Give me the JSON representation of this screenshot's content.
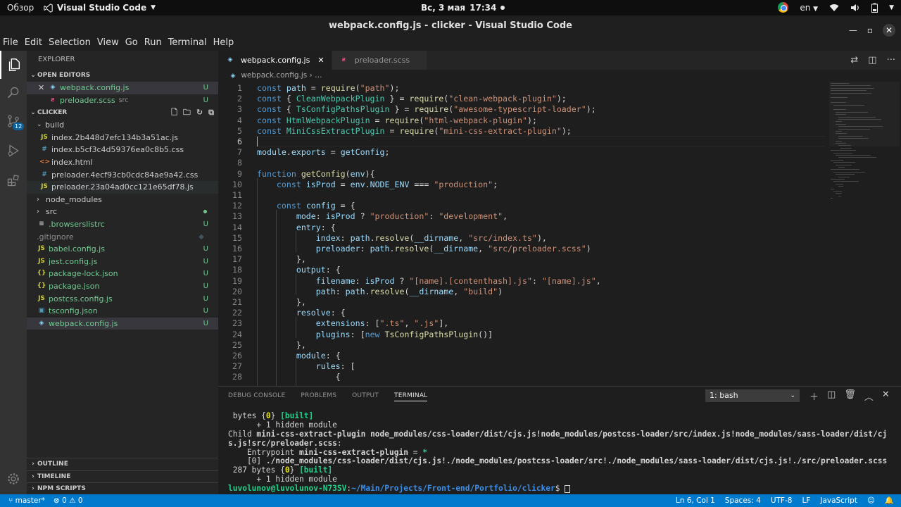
{
  "gnome": {
    "activities": "Обзор",
    "app_name": "Visual Studio Code",
    "date": "Вс, 3 мая",
    "time": "17:34",
    "language": "en"
  },
  "window": {
    "title": "webpack.config.js - clicker - Visual Studio Code"
  },
  "menu": [
    "File",
    "Edit",
    "Selection",
    "View",
    "Go",
    "Run",
    "Terminal",
    "Help"
  ],
  "activity_bar": {
    "scm_badge": "12"
  },
  "explorer": {
    "title": "EXPLORER",
    "open_editors_label": "OPEN EDITORS",
    "open_editors": [
      {
        "name": "webpack.config.js",
        "desc": "",
        "git": "U"
      },
      {
        "name": "preloader.scss",
        "desc": "src",
        "git": "U"
      }
    ],
    "project_label": "CLICKER",
    "build_folder": "build",
    "build_files": [
      "index.2b448d7efc134b3a51ac.js",
      "index.b5cf3c4d59376ea0c8b5.css",
      "index.html",
      "preloader.4ecf93cb0cdc84ae9a42.css",
      "preloader.23a04ad0cc121e65df78.js"
    ],
    "folders": [
      "node_modules",
      "src"
    ],
    "files": [
      {
        "name": ".browserslistrc",
        "git": "U"
      },
      {
        "name": ".gitignore",
        "git": ""
      },
      {
        "name": "babel.config.js",
        "git": "U"
      },
      {
        "name": "jest.config.js",
        "git": "U"
      },
      {
        "name": "package-lock.json",
        "git": "U"
      },
      {
        "name": "package.json",
        "git": "U"
      },
      {
        "name": "postcss.config.js",
        "git": "U"
      },
      {
        "name": "tsconfig.json",
        "git": "U"
      },
      {
        "name": "webpack.config.js",
        "git": "U"
      }
    ],
    "bottom_sections": [
      "OUTLINE",
      "TIMELINE",
      "NPM SCRIPTS"
    ]
  },
  "tabs": [
    {
      "label": "webpack.config.js",
      "active": true
    },
    {
      "label": "preloader.scss",
      "active": false
    }
  ],
  "breadcrumb": [
    "webpack.config.js",
    "…"
  ],
  "code_lines": [
    {
      "n": "1",
      "t": "const path = require(\"path\");"
    },
    {
      "n": "2",
      "t": "const { CleanWebpackPlugin } = require(\"clean-webpack-plugin\");"
    },
    {
      "n": "3",
      "t": "const { TsConfigPathsPlugin } = require(\"awesome-typescript-loader\");"
    },
    {
      "n": "4",
      "t": "const HtmlWebpackPlugin = require(\"html-webpack-plugin\");"
    },
    {
      "n": "5",
      "t": "const MiniCssExtractPlugin = require(\"mini-css-extract-plugin\");"
    },
    {
      "n": "6",
      "t": ""
    },
    {
      "n": "7",
      "t": "module.exports = getConfig;"
    },
    {
      "n": "8",
      "t": ""
    },
    {
      "n": "9",
      "t": "function getConfig(env){"
    },
    {
      "n": "10",
      "t": "    const isProd = env.NODE_ENV === \"production\";"
    },
    {
      "n": "11",
      "t": ""
    },
    {
      "n": "12",
      "t": "    const config = {"
    },
    {
      "n": "13",
      "t": "        mode: isProd ? \"production\": \"development\","
    },
    {
      "n": "14",
      "t": "        entry: {"
    },
    {
      "n": "15",
      "t": "            index: path.resolve(__dirname, \"src/index.ts\"),"
    },
    {
      "n": "16",
      "t": "            preloader: path.resolve(__dirname, \"src/preloader.scss\")"
    },
    {
      "n": "17",
      "t": "        },"
    },
    {
      "n": "18",
      "t": "        output: {"
    },
    {
      "n": "19",
      "t": "            filename: isProd ? \"[name].[contenthash].js\": \"[name].js\","
    },
    {
      "n": "20",
      "t": "            path: path.resolve(__dirname, \"build\")"
    },
    {
      "n": "21",
      "t": "        },"
    },
    {
      "n": "22",
      "t": "        resolve: {"
    },
    {
      "n": "23",
      "t": "            extensions: [\".ts\", \".js\"],"
    },
    {
      "n": "24",
      "t": "            plugins: [new TsConfigPathsPlugin()]"
    },
    {
      "n": "25",
      "t": "        },"
    },
    {
      "n": "26",
      "t": "        module: {"
    },
    {
      "n": "27",
      "t": "            rules: ["
    },
    {
      "n": "28",
      "t": "                {"
    }
  ],
  "panel": {
    "tabs": [
      "DEBUG CONSOLE",
      "PROBLEMS",
      "OUTPUT",
      "TERMINAL"
    ],
    "active_tab": "TERMINAL",
    "terminal_select": "1: bash"
  },
  "terminal": {
    "l1_pre": " bytes {",
    "l1_id": "0",
    "l1_mid": "} ",
    "l1_built": "[built]",
    "l2": "      + 1 hidden module",
    "l3_pre": "Child ",
    "l3_bold": "mini-css-extract-plugin node_modules/css-loader/dist/cjs.js!node_modules/postcss-loader/src/index.js!node_modules/sass-loader/dist/cj",
    "l4_bold": "s.js!src/preloader.scss",
    "l4_post": ":",
    "l5_pre": "    Entrypoint ",
    "l5_bold": "mini-css-extract-plugin",
    "l5_mid": " = ",
    "l5_star": "*",
    "l6_pre": "    [0] ",
    "l6_bold": "./node_modules/css-loader/dist/cjs.js!./node_modules/postcss-loader/src!./node_modules/sass-loader/dist/cjs.js!./src/preloader.scss",
    "l7_pre": " 287 bytes {",
    "l7_id": "0",
    "l7_mid": "} ",
    "l7_built": "[built]",
    "l8": "      + 1 hidden module",
    "prompt_user": "luvolunov@luvolunov-N73SV",
    "prompt_sep": ":",
    "prompt_path": "~/Main/Projects/Front-end/Portfolio/clicker",
    "prompt_end": "$ "
  },
  "status": {
    "branch": "master*",
    "errors": "0",
    "warnings": "0",
    "position": "Ln 6, Col 1",
    "spaces": "Spaces: 4",
    "encoding": "UTF-8",
    "eol": "LF",
    "language": "JavaScript"
  },
  "colors": {
    "statusbar": "#007acc",
    "keyword": "#569cd6",
    "string": "#ce9178",
    "function": "#dcdcaa",
    "class": "#4ec9b0",
    "git_untracked": "#73c991"
  }
}
